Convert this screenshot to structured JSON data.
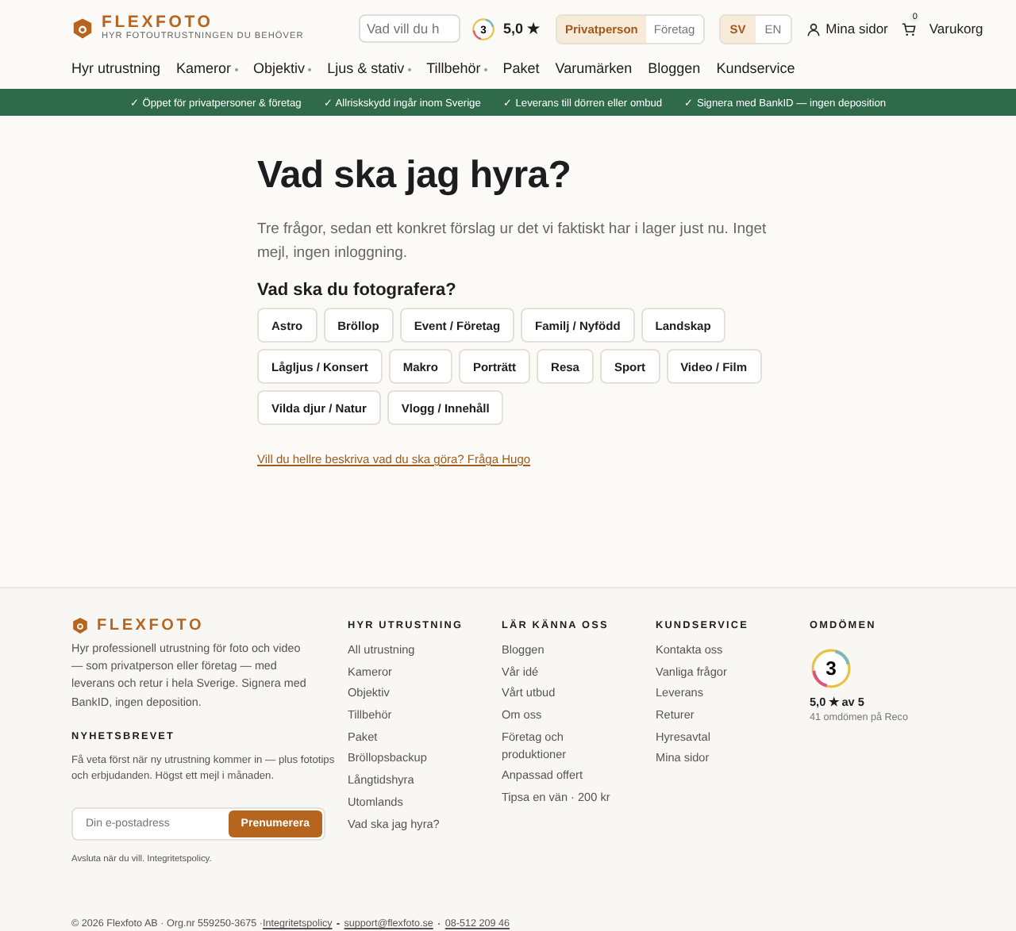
{
  "header": {
    "logo": "FLEXFOTO",
    "tagline": "HYR FOTOUTRUSTNINGEN DU BEHÖVER",
    "search": {
      "placeholder": "Vad vill du h"
    },
    "rating_badge": "3",
    "rating": "5,0 ★",
    "customer_types": [
      {
        "label": "Privatperson",
        "selected": true
      },
      {
        "label": "Företag",
        "selected": false
      }
    ],
    "languages": [
      {
        "label": "SV",
        "selected": true
      },
      {
        "label": "EN",
        "selected": false
      }
    ],
    "account": "Mina sidor",
    "cart_count": "0",
    "cart": "Varukorg"
  },
  "nav": [
    {
      "label": "Hyr utrustning",
      "dropdown": false
    },
    {
      "label": "Kameror",
      "dropdown": true
    },
    {
      "label": "Objektiv",
      "dropdown": true
    },
    {
      "label": "Ljus & stativ",
      "dropdown": true
    },
    {
      "label": "Tillbehör",
      "dropdown": true
    },
    {
      "label": "Paket",
      "dropdown": false
    },
    {
      "label": "Varumärken",
      "dropdown": false
    },
    {
      "label": "Bloggen",
      "dropdown": false
    },
    {
      "label": "Kundservice",
      "dropdown": false
    }
  ],
  "usp_bar": [
    "✓ Öppet för privatpersoner & företag",
    "✓ Allriskskydd ingår inom Sverige",
    "✓ Leverans till dörren eller ombud",
    "✓ Signera med BankID — ingen deposition"
  ],
  "main": {
    "title": "Vad ska jag hyra?",
    "intro": "Tre frågor, sedan ett konkret förslag ur det vi faktiskt har i lager just nu. Inget mejl, ingen inloggning.",
    "question": "Vad ska du fotografera?",
    "options": [
      "Astro",
      "Bröllop",
      "Event / Företag",
      "Familj / Nyfödd",
      "Landskap",
      "Lågljus / Konsert",
      "Makro",
      "Porträtt",
      "Resa",
      "Sport",
      "Video / Film",
      "Vilda djur / Natur",
      "Vlogg / Innehåll"
    ],
    "help_link": "Vill du hellre beskriva vad du ska göra? Fråga Hugo"
  },
  "footer": {
    "logo": "FLEXFOTO",
    "about": "Hyr professionell utrustning för foto och video — som privatperson eller företag — med leverans och retur i hela Sverige. Signera med BankID, ingen deposition.",
    "newsletter": {
      "title": "NYHETSBREVET",
      "text": "Få veta först när ny utrustning kommer in — plus fototips och erbjudanden. Högst ett mejl i månaden.",
      "placeholder": "Din e-postadress",
      "button": "Prenumerera",
      "note": "Avsluta när du vill. Integritetspolicy."
    },
    "columns": [
      {
        "title": "HYR UTRUSTNING",
        "links": [
          "All utrustning",
          "Kameror",
          "Objektiv",
          "Tillbehör",
          "Paket",
          "Bröllopsbackup",
          "Långtidshyra",
          "Utomlands",
          "Vad ska jag hyra?"
        ]
      },
      {
        "title": "LÄR KÄNNA OSS",
        "links": [
          "Bloggen",
          "Vår idé",
          "Vårt utbud",
          "Om oss",
          "Företag och produktioner",
          "Anpassad offert",
          "Tipsa en vän · 200 kr"
        ]
      },
      {
        "title": "KUNDSERVICE",
        "links": [
          "Kontakta oss",
          "Vanliga frågor",
          "Leverans",
          "Returer",
          "Hyresavtal",
          "Mina sidor"
        ]
      }
    ],
    "reviews": {
      "title": "OMDÖMEN",
      "badge": "3",
      "score": "5,0 ★ av 5",
      "count": "41 omdömen på Reco"
    },
    "legal": {
      "text": "© 2026 Flexfoto AB · Org.nr 559250-3675 · ",
      "links": [
        "Integritetspolicy",
        "support@flexfoto.se",
        "08-512 209 46"
      ]
    }
  }
}
